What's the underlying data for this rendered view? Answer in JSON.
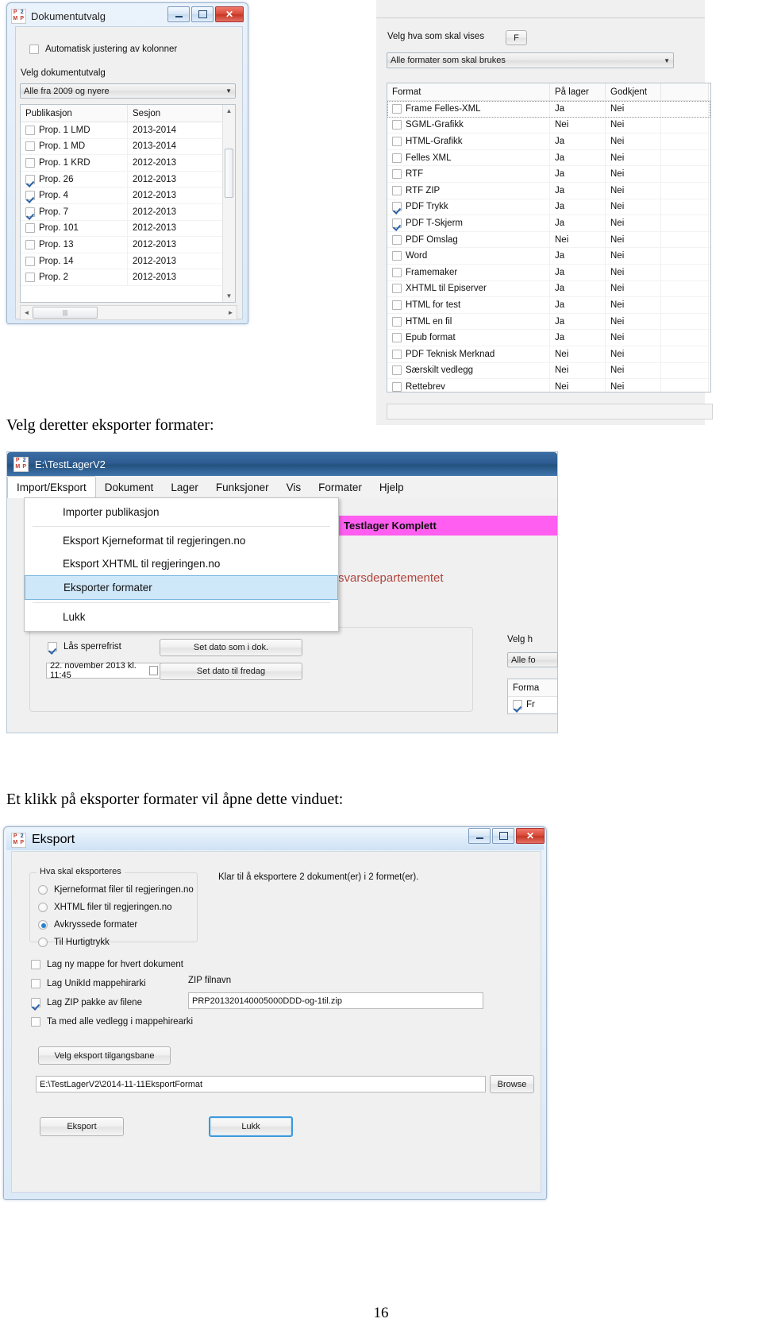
{
  "document": {
    "paragraph_1": "Velg deretter eksporter formater:",
    "paragraph_2": "Et klikk på eksporter formater vil åpne dette vinduet:",
    "page_number": "16"
  },
  "dokumentutvalg_window": {
    "title": "Dokumentutvalg",
    "logo": {
      "p": "P",
      "two": "2",
      "m": "M",
      "p2": "P"
    },
    "window_buttons": {
      "minimize": "–",
      "maximize": "□",
      "close": "✕"
    },
    "auto_adjust_checkbox": {
      "label": "Automatisk justering av kolonner",
      "checked": false
    },
    "select_label": "Velg dokumentutvalg",
    "select_value": "Alle fra 2009 og nyere",
    "columns": [
      "Publikasjon",
      "Sesjon"
    ],
    "rows": [
      {
        "checked": false,
        "publikasjon": "Prop. 1   LMD",
        "sesjon": "2013-2014"
      },
      {
        "checked": false,
        "publikasjon": "Prop. 1   MD",
        "sesjon": "2013-2014"
      },
      {
        "checked": false,
        "publikasjon": "Prop. 1   KRD",
        "sesjon": "2012-2013"
      },
      {
        "checked": true,
        "publikasjon": "Prop. 26",
        "sesjon": "2012-2013"
      },
      {
        "checked": true,
        "publikasjon": "Prop. 4",
        "sesjon": "2012-2013"
      },
      {
        "checked": true,
        "publikasjon": "Prop. 7",
        "sesjon": "2012-2013"
      },
      {
        "checked": false,
        "publikasjon": "Prop. 101",
        "sesjon": "2012-2013"
      },
      {
        "checked": false,
        "publikasjon": "Prop. 13",
        "sesjon": "2012-2013"
      },
      {
        "checked": false,
        "publikasjon": "Prop. 14",
        "sesjon": "2012-2013"
      },
      {
        "checked": false,
        "publikasjon": "Prop. 2",
        "sesjon": "2012-2013"
      }
    ],
    "scroll_up": "▲",
    "scroll_down": "▼",
    "hscroll_left": "◄",
    "hscroll_right": "►",
    "hscroll_grip": "|||"
  },
  "formater_panel": {
    "filter_label": "Velg hva som skal vises",
    "filter_button": "F",
    "select_value": "Alle formater som skal brukes",
    "columns": [
      "Format",
      "På lager",
      "Godkjent"
    ],
    "rows": [
      {
        "checked": false,
        "format": "Frame Felles-XML",
        "pa_lager": "Ja",
        "godkjent": "Nei"
      },
      {
        "checked": false,
        "format": "SGML-Grafikk",
        "pa_lager": "Nei",
        "godkjent": "Nei"
      },
      {
        "checked": false,
        "format": "HTML-Grafikk",
        "pa_lager": "Ja",
        "godkjent": "Nei"
      },
      {
        "checked": false,
        "format": "Felles XML",
        "pa_lager": "Ja",
        "godkjent": "Nei"
      },
      {
        "checked": false,
        "format": "RTF",
        "pa_lager": "Ja",
        "godkjent": "Nei"
      },
      {
        "checked": false,
        "format": "RTF ZIP",
        "pa_lager": "Ja",
        "godkjent": "Nei"
      },
      {
        "checked": true,
        "format": "PDF Trykk",
        "pa_lager": "Ja",
        "godkjent": "Nei"
      },
      {
        "checked": true,
        "format": "PDF T-Skjerm",
        "pa_lager": "Ja",
        "godkjent": "Nei"
      },
      {
        "checked": false,
        "format": "PDF Omslag",
        "pa_lager": "Nei",
        "godkjent": "Nei"
      },
      {
        "checked": false,
        "format": "Word",
        "pa_lager": "Ja",
        "godkjent": "Nei"
      },
      {
        "checked": false,
        "format": "Framemaker",
        "pa_lager": "Ja",
        "godkjent": "Nei"
      },
      {
        "checked": false,
        "format": "XHTML til Episerver",
        "pa_lager": "Ja",
        "godkjent": "Nei"
      },
      {
        "checked": false,
        "format": "HTML for test",
        "pa_lager": "Ja",
        "godkjent": "Nei"
      },
      {
        "checked": false,
        "format": "HTML en fil",
        "pa_lager": "Ja",
        "godkjent": "Nei"
      },
      {
        "checked": false,
        "format": "Epub format",
        "pa_lager": "Ja",
        "godkjent": "Nei"
      },
      {
        "checked": false,
        "format": "PDF Teknisk Merknad",
        "pa_lager": "Nei",
        "godkjent": "Nei"
      },
      {
        "checked": false,
        "format": "Særskilt vedlegg",
        "pa_lager": "Nei",
        "godkjent": "Nei"
      },
      {
        "checked": false,
        "format": "Rettebrev",
        "pa_lager": "Nei",
        "godkjent": "Nei"
      }
    ]
  },
  "main_window": {
    "title": "E:\\TestLagerV2",
    "logo": {
      "p": "P",
      "two": "2",
      "m": "M",
      "p2": "P"
    },
    "menubar": [
      "Import/Eksport",
      "Dokument",
      "Lager",
      "Funksjoner",
      "Vis",
      "Formater",
      "Hjelp"
    ],
    "dropdown_items": [
      {
        "label": "Importer publikasjon",
        "selected": false
      },
      {
        "label": "Eksport Kjerneformat til regjeringen.no",
        "selected": false
      },
      {
        "label": "Eksport XHTML til regjeringen.no",
        "selected": false
      },
      {
        "label": "Eksporter formater",
        "selected": true
      },
      {
        "label": "Lukk",
        "selected": false
      }
    ],
    "banner": "Testlager Komplett",
    "department": "rsvarsdepartementet",
    "lock_checkbox": {
      "label": "Lås sperrefrist",
      "checked": true
    },
    "date_value": "22. november 2013  kl. 11:45",
    "btn_set_date_doc": "Set dato som i dok.",
    "btn_set_date_friday": "Set dato til fredag",
    "side_label": "Velg h",
    "side_combo": "Alle fo",
    "side_list_header": "Forma",
    "side_list_row": "Fr"
  },
  "eksport_dialog": {
    "title": "Eksport",
    "logo": {
      "p": "P",
      "two": "2",
      "m": "M",
      "p2": "P"
    },
    "window_buttons": {
      "minimize": "–",
      "maximize": "□",
      "close": "✕"
    },
    "group_legend": "Hva skal eksporteres",
    "radios": [
      {
        "label": "Kjerneformat filer til regjeringen.no",
        "selected": false
      },
      {
        "label": "XHTML filer til regjeringen.no",
        "selected": false
      },
      {
        "label": "Avkryssede formater",
        "selected": true
      },
      {
        "label": "Til Hurtigtrykk",
        "selected": false
      }
    ],
    "status_text": "Klar til å eksportere 2 dokument(er) i 2 formet(er).",
    "checkboxes": [
      {
        "label": "Lag ny mappe for hvert dokument",
        "checked": false
      },
      {
        "label": "Lag UnikId mappehirarki",
        "checked": false
      },
      {
        "label": "Lag ZIP pakke av filene",
        "checked": true
      },
      {
        "label": "Ta med alle vedlegg i mappehirearki",
        "checked": false
      }
    ],
    "zip_label": "ZIP filnavn",
    "zip_value": "PRP201320140005000DDD-og-1til.zip",
    "path_button": "Velg eksport tilgangsbane",
    "path_value": "E:\\TestLagerV2\\2014-11-11EksportFormat",
    "browse_button": "Browse",
    "export_button": "Eksport",
    "close_button": "Lukk"
  }
}
